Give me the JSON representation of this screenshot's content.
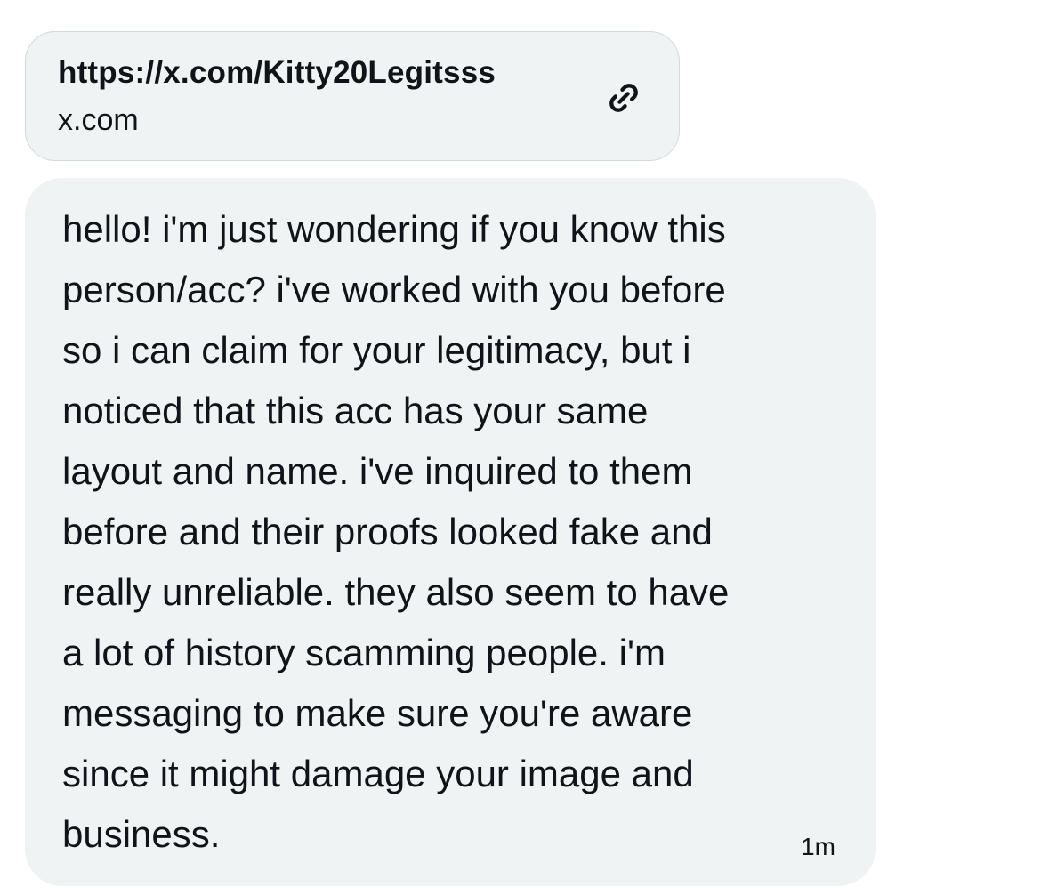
{
  "link_card": {
    "url": "https://x.com/Kitty20Legitsss",
    "domain": "x.com",
    "icon": "link-icon"
  },
  "message": {
    "lines": [
      "hello! i'm just wondering if you know this",
      "person/acc? i've worked with you before",
      "so i can claim for your legitimacy, but i",
      "noticed that this acc has your same",
      "layout and name. i've inquired to them",
      "before and their proofs looked fake and",
      "really unreliable. they also seem to have",
      "a lot of history scamming people. i'm",
      "messaging to make sure you're aware",
      "since it might damage your image and",
      "business."
    ],
    "timestamp": "1m"
  },
  "colors": {
    "bubble_background": "#eff3f4",
    "card_border": "#cfd9de",
    "text": "#0f1419"
  }
}
